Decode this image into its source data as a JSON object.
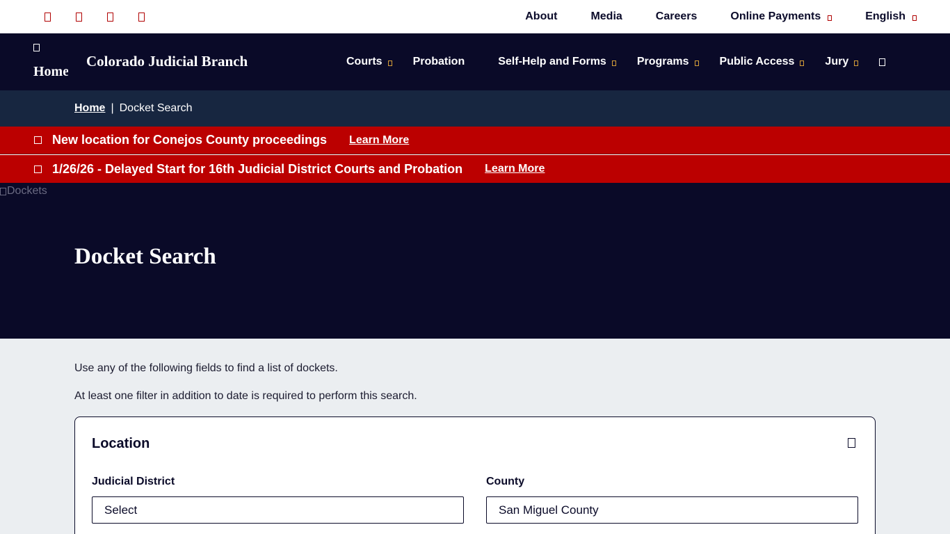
{
  "utility": {
    "social_icons": [
      "facebook-icon",
      "twitter-icon",
      "youtube-icon",
      "instagram-icon"
    ],
    "links": [
      {
        "label": "About",
        "has_caret": false
      },
      {
        "label": "Media",
        "has_caret": false
      },
      {
        "label": "Careers",
        "has_caret": false
      },
      {
        "label": "Online Payments",
        "has_caret": true
      },
      {
        "label": "English",
        "has_caret": true
      }
    ]
  },
  "header": {
    "logo_alt": "Home",
    "site_title": "Colorado Judicial Branch",
    "nav": [
      {
        "label": "Courts",
        "has_caret": true
      },
      {
        "label": "Probation",
        "has_caret": false
      },
      {
        "label": "Self-Help and Forms",
        "has_caret": true
      },
      {
        "label": "Programs",
        "has_caret": true
      },
      {
        "label": "Public Access",
        "has_caret": true
      },
      {
        "label": "Jury",
        "has_caret": true
      }
    ]
  },
  "breadcrumb": {
    "home": "Home",
    "separator": "|",
    "current": "Docket Search"
  },
  "alerts": [
    {
      "text": "New location for Conejos County proceedings",
      "link": "Learn More"
    },
    {
      "text": "1/26/26 - Delayed Start for 16th Judicial District Courts and Probation",
      "link": "Learn More"
    }
  ],
  "hero": {
    "image_alt": "Dockets",
    "title": "Docket Search"
  },
  "content": {
    "intro1": "Use any of the following fields to find a list of dockets.",
    "intro2": "At least one filter in addition to date is required to perform this search.",
    "location": {
      "title": "Location",
      "judicial_district_label": "Judicial District",
      "judicial_district_value": "Select",
      "county_label": "County",
      "county_value": "San Miguel County"
    }
  },
  "colors": {
    "navy": "#0a0a28",
    "breadcrumb_bg": "#172640",
    "alert_red": "#bb0000",
    "content_bg": "#ebeef1",
    "accent_gold": "#d8a038"
  }
}
